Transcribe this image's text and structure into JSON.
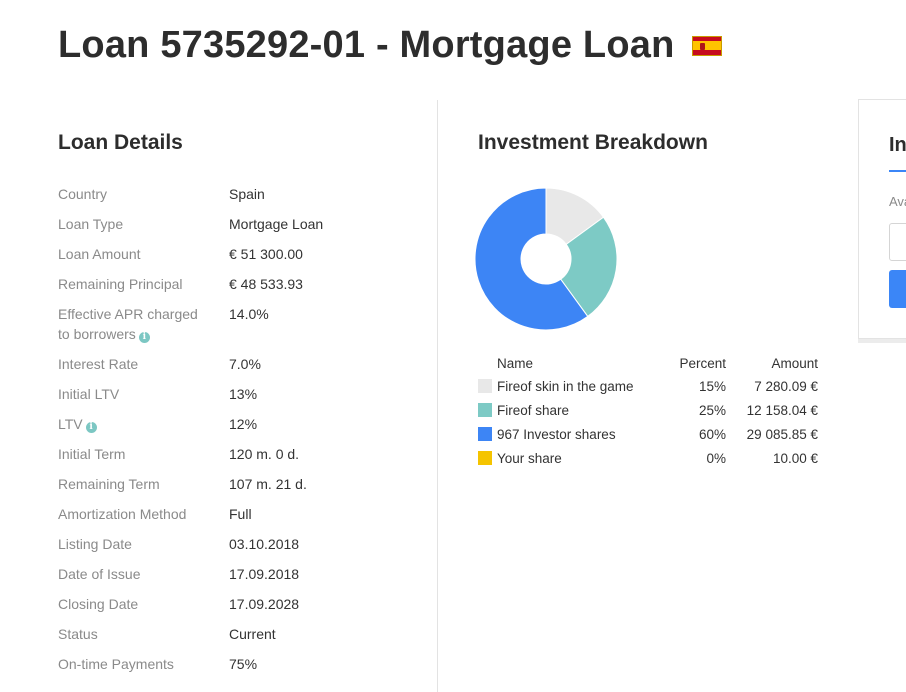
{
  "header": {
    "title": "Loan 5735292-01 - Mortgage Loan",
    "flag_icon": "spain-flag-icon"
  },
  "loan_details": {
    "title": "Loan Details",
    "rows": [
      {
        "label": "Country",
        "value": "Spain"
      },
      {
        "label": "Loan Type",
        "value": "Mortgage Loan"
      },
      {
        "label": "Loan Amount",
        "value": "€ 51 300.00"
      },
      {
        "label": "Remaining Principal",
        "value": "€ 48 533.93"
      },
      {
        "label": "Effective APR charged",
        "label2": "to borrowers",
        "value": "14.0%",
        "info": true
      },
      {
        "label": "Interest Rate",
        "value": "7.0%"
      },
      {
        "label": "Initial LTV",
        "value": "13%"
      },
      {
        "label": "LTV",
        "value": "12%",
        "info": true
      },
      {
        "label": "Initial Term",
        "value": "120 m. 0 d."
      },
      {
        "label": "Remaining Term",
        "value": "107 m. 21 d."
      },
      {
        "label": "Amortization Method",
        "value": "Full"
      },
      {
        "label": "Listing Date",
        "value": "03.10.2018"
      },
      {
        "label": "Date of Issue",
        "value": "17.09.2018"
      },
      {
        "label": "Closing Date",
        "value": "17.09.2028"
      },
      {
        "label": "Status",
        "value": "Current"
      },
      {
        "label": "On-time Payments",
        "value": "75%"
      }
    ]
  },
  "investment_breakdown": {
    "title": "Investment Breakdown",
    "headers": {
      "name": "Name",
      "percent": "Percent",
      "amount": "Amount"
    },
    "items": [
      {
        "name": "Fireof skin in the game",
        "percent": "15%",
        "amount": "7 280.09 €",
        "color": "#e8e8e8"
      },
      {
        "name": "Fireof share",
        "percent": "25%",
        "amount": "12 158.04 €",
        "color": "#7dcac5"
      },
      {
        "name": "967 Investor shares",
        "percent": "60%",
        "amount": "29 085.85 €",
        "color": "#3d85f5"
      },
      {
        "name": "Your share",
        "percent": "0%",
        "amount": "10.00 €",
        "color": "#f5c400"
      }
    ]
  },
  "chart_data": {
    "type": "pie",
    "categories": [
      "Fireof skin in the game",
      "Fireof share",
      "967 Investor shares",
      "Your share"
    ],
    "values": [
      15,
      25,
      60,
      0
    ],
    "colors": [
      "#e8e8e8",
      "#7dcac5",
      "#3d85f5",
      "#f5c400"
    ],
    "donut": true
  },
  "side_panel": {
    "title": "In",
    "avail": "Ava"
  }
}
